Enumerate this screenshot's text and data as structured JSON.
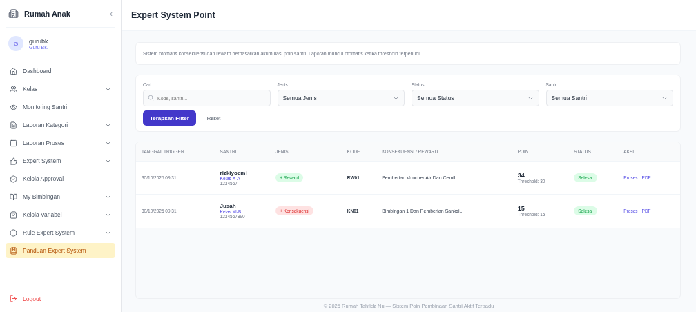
{
  "sidebar": {
    "brand": "Rumah Anak",
    "collapse": "‹",
    "user": {
      "initial": "G",
      "name": "gurubk",
      "role": "Guru BK"
    },
    "items": [
      {
        "label": "Dashboard",
        "expandable": false,
        "selected": false
      },
      {
        "label": "Kelas",
        "expandable": true,
        "selected": false
      },
      {
        "label": "Monitoring Santri",
        "expandable": false,
        "selected": false
      },
      {
        "label": "Laporan Kategori",
        "expandable": true,
        "selected": false
      },
      {
        "label": "Laporan Proses",
        "expandable": true,
        "selected": false
      },
      {
        "label": "Expert System",
        "expandable": true,
        "selected": false
      },
      {
        "label": "Kelola Approval",
        "expandable": false,
        "selected": false
      },
      {
        "label": "My Bimbingan",
        "expandable": true,
        "selected": false
      },
      {
        "label": "Kelola Variabel",
        "expandable": true,
        "selected": false
      },
      {
        "label": "Rule Expert System",
        "expandable": true,
        "selected": false
      },
      {
        "label": "Panduan Expert System",
        "expandable": false,
        "selected": true
      }
    ],
    "logout": "Logout"
  },
  "page": {
    "title": "Expert System Point"
  },
  "description": "Sistem otomatis konsekuensi dan reward berdasarkan akumulasi poin santri. Laporan muncul otomatis ketika threshold terpenuhi.",
  "filters": {
    "fields": [
      {
        "kind": "search",
        "label": "Cari",
        "placeholder": "Kode, santri..."
      },
      {
        "kind": "select",
        "label": "Jenis",
        "value": "Semua Jenis"
      },
      {
        "kind": "select",
        "label": "Status",
        "value": "Semua Status"
      },
      {
        "kind": "select",
        "label": "Santri",
        "value": "Semua Santri"
      }
    ],
    "apply": "Terapkan Filter",
    "reset": "Reset"
  },
  "table": {
    "columns": [
      "TANGGAL TRIGGER",
      "SANTRI",
      "JENIS",
      "KODE",
      "KONSEKUENSI / REWARD",
      "POIN",
      "STATUS",
      "AKSI"
    ],
    "rows": [
      {
        "date": "30/10/2025 09:31",
        "name": "rizkiyoemi",
        "class": "Kelas X-A",
        "nis": "1234567",
        "kind": "reward",
        "type_label": "+ Reward",
        "code": "RW01",
        "action": "Pemberian Voucher Air Dan Cemil...",
        "points": "34",
        "threshold": "Threshold: 30",
        "status": "Selesai",
        "links": [
          "Proses",
          "PDF"
        ]
      },
      {
        "date": "30/10/2025 09:31",
        "name": "Jusah",
        "class": "Kelas XI-B",
        "nis": "1234567890",
        "kind": "konsekuensi",
        "type_label": "+ Konsekuensi",
        "code": "KN01",
        "action": "Bimbingan 1 Dan Pemberian Sanksi...",
        "points": "15",
        "threshold": "Threshold: 15",
        "status": "Selesai",
        "links": [
          "Proses",
          "PDF"
        ]
      }
    ]
  },
  "footer": "© 2025 Rumah Tahfidz Nu — Sistem Poin Pembinaan Santri Aktif Terpadu"
}
